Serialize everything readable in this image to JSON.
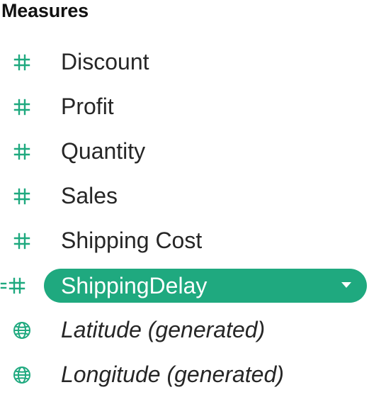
{
  "panel": {
    "title": "Measures",
    "accent_color": "#1fa97f",
    "items": [
      {
        "label": "Discount",
        "icon": "number-hash-icon",
        "selected": false,
        "italic": false
      },
      {
        "label": "Profit",
        "icon": "number-hash-icon",
        "selected": false,
        "italic": false
      },
      {
        "label": "Quantity",
        "icon": "number-hash-icon",
        "selected": false,
        "italic": false
      },
      {
        "label": "Sales",
        "icon": "number-hash-icon",
        "selected": false,
        "italic": false
      },
      {
        "label": "Shipping Cost",
        "icon": "number-hash-icon",
        "selected": false,
        "italic": false
      },
      {
        "label": "ShippingDelay",
        "icon": "calculated-number-icon",
        "selected": true,
        "italic": false
      },
      {
        "label": "Latitude (generated)",
        "icon": "globe-icon",
        "selected": false,
        "italic": true
      },
      {
        "label": "Longitude (generated)",
        "icon": "globe-icon",
        "selected": false,
        "italic": true
      }
    ]
  }
}
